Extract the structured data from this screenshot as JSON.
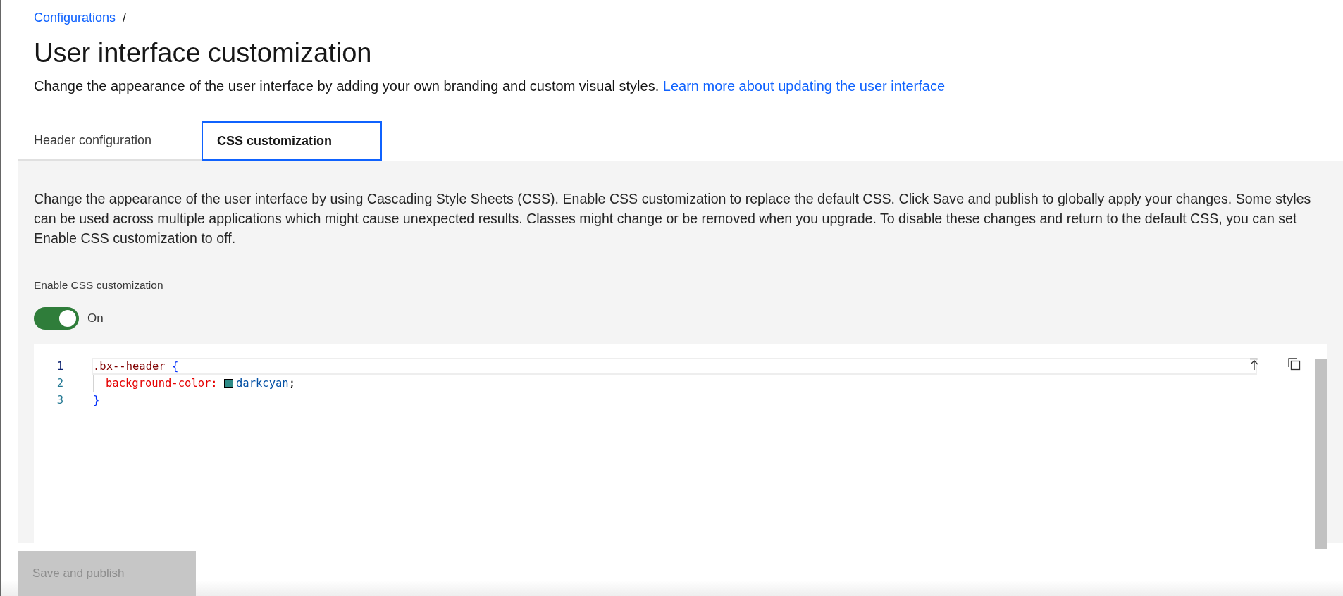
{
  "breadcrumb": {
    "link": "Configurations",
    "separator": "/"
  },
  "title": "User interface customization",
  "description": {
    "text": "Change the appearance of the user interface by adding your own branding and custom visual styles.",
    "link": "Learn more about updating the user interface"
  },
  "tabs": [
    {
      "label": "Header configuration",
      "selected": false
    },
    {
      "label": "CSS customization",
      "selected": true
    }
  ],
  "panel": {
    "paragraph": "Change the appearance of the user interface by using Cascading Style Sheets (CSS). Enable CSS customization to replace the default CSS. Click Save and publish to globally apply your changes. Some styles can be used across multiple applications which might cause unexpected results. Classes might change or be removed when you upgrade. To disable these changes and return to the default CSS, you can set Enable CSS customization to off.",
    "toggle": {
      "label": "Enable CSS customization",
      "on": true,
      "state_text": "On"
    },
    "editor": {
      "lines": [
        {
          "number": "1",
          "current": true,
          "tokens": [
            {
              "kind": "selector",
              "text": ".bx--header"
            },
            {
              "kind": "brace",
              "text": "{"
            }
          ]
        },
        {
          "number": "2",
          "current": false,
          "indent": true,
          "tokens": [
            {
              "kind": "property",
              "text": "background-color:"
            },
            {
              "kind": "value",
              "text": "darkcyan",
              "color": "#2e8b87"
            },
            {
              "kind": "punct",
              "text": ";"
            }
          ]
        },
        {
          "number": "3",
          "current": false,
          "tokens": [
            {
              "kind": "brace",
              "text": "}"
            }
          ]
        }
      ]
    }
  },
  "save_button": {
    "label": "Save and publish",
    "disabled": true
  }
}
